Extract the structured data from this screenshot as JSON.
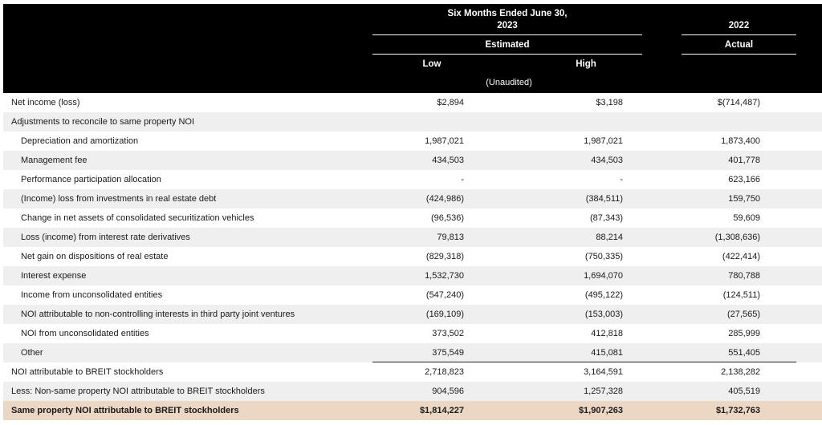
{
  "header": {
    "period_line1": "Six Months Ended June 30,",
    "period_line2": "2023",
    "prior_year": "2022",
    "estimated": "Estimated",
    "actual": "Actual",
    "low": "Low",
    "high": "High",
    "unaudited": "(Unaudited)"
  },
  "rows": [
    {
      "label": "Net income (loss)",
      "low": "$2,894",
      "high": "$3,198",
      "actual": "$(714,487)"
    },
    {
      "label": "Adjustments to reconcile to same property NOI",
      "low": "",
      "high": "",
      "actual": ""
    },
    {
      "label": "Depreciation and amortization",
      "low": "1,987,021",
      "high": "1,987,021",
      "actual": "1,873,400"
    },
    {
      "label": "Management fee",
      "low": "434,503",
      "high": "434,503",
      "actual": "401,778"
    },
    {
      "label": "Performance participation allocation",
      "low": "-",
      "high": "-",
      "actual": "623,166"
    },
    {
      "label": "(Income) loss from investments in real estate debt",
      "low": "(424,986)",
      "high": "(384,511)",
      "actual": "159,750"
    },
    {
      "label": "Change in net assets of consolidated securitization vehicles",
      "low": "(96,536)",
      "high": "(87,343)",
      "actual": "59,609"
    },
    {
      "label": "Loss (income) from interest rate derivatives",
      "low": "79,813",
      "high": "88,214",
      "actual": "(1,308,636)"
    },
    {
      "label": "Net gain on dispositions of real estate",
      "low": "(829,318)",
      "high": "(750,335)",
      "actual": "(422,414)"
    },
    {
      "label": "Interest expense",
      "low": "1,532,730",
      "high": "1,694,070",
      "actual": "780,788"
    },
    {
      "label": "Income from unconsolidated entities",
      "low": "(547,240)",
      "high": "(495,122)",
      "actual": "(124,511)"
    },
    {
      "label": "NOI attributable to non-controlling interests in third party joint ventures",
      "low": "(169,109)",
      "high": "(153,003)",
      "actual": "(27,565)"
    },
    {
      "label": "NOI from unconsolidated entities",
      "low": "373,502",
      "high": "412,818",
      "actual": "285,999"
    },
    {
      "label": "Other",
      "low": "375,549",
      "high": "415,081",
      "actual": "551,405"
    },
    {
      "label": "NOI attributable to BREIT stockholders",
      "low": "2,718,823",
      "high": "3,164,591",
      "actual": "2,138,282"
    },
    {
      "label": "Less: Non-same property NOI attributable to BREIT stockholders",
      "low": "904,596",
      "high": "1,257,328",
      "actual": "405,519"
    },
    {
      "label": "Same property NOI attributable to BREIT stockholders",
      "low": "$1,814,227",
      "high": "$1,907,263",
      "actual": "$1,732,763"
    }
  ]
}
